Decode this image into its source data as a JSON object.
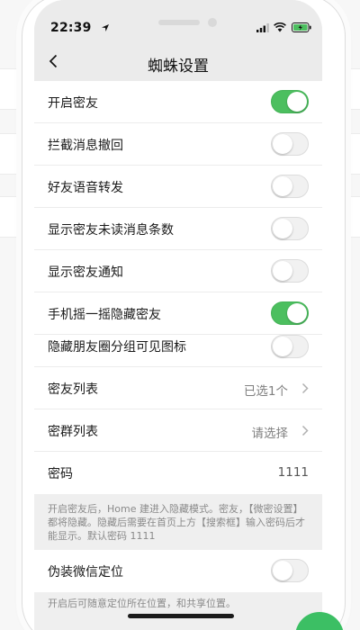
{
  "status_bar": {
    "time": "22:39"
  },
  "nav": {
    "title": "蜘蛛设置"
  },
  "toggles": [
    {
      "label": "开启密友",
      "on": true
    },
    {
      "label": "拦截消息撤回",
      "on": false
    },
    {
      "label": "好友语音转发",
      "on": false
    },
    {
      "label": "显示密友未读消息条数",
      "on": false
    },
    {
      "label": "显示密友通知",
      "on": false
    },
    {
      "label": "手机摇一摇隐藏密友",
      "on": true
    },
    {
      "label": "隐藏朋友圈分组可见图标",
      "on": false
    }
  ],
  "list_rows": {
    "friends": {
      "label": "密友列表",
      "value": "已选1个"
    },
    "groups": {
      "label": "密群列表",
      "value": "请选择"
    },
    "password": {
      "label": "密码",
      "value": "1111"
    }
  },
  "notes": {
    "secret_friend": "开启密友后，Home 建进入隐藏模式。密友，【微密设置】都将隐藏。隐藏后需要在首页上方【搜索框】输入密码后才能显示。默认密码 1111",
    "fake_location": "开启后可随意定位所在位置，和共享位置。"
  },
  "location": {
    "label": "伪装微信定位",
    "on": false
  },
  "colors": {
    "toggle_on": "#4cbf5f",
    "toggle_off": "#f1f1f1",
    "background": "#efefef",
    "fab": "#3cbf64"
  },
  "icons": {
    "back": "chevron-left-icon",
    "arrow": "chevron-right-icon",
    "location_arrow": "location-arrow-icon",
    "signal": "cellular-signal-icon",
    "wifi": "wifi-icon",
    "battery": "battery-charging-icon"
  }
}
